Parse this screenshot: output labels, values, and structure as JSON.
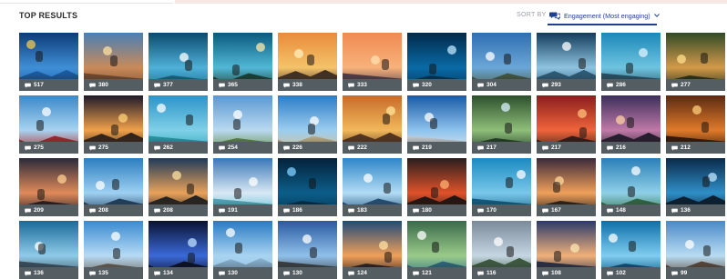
{
  "header": {
    "title": "TOP RESULTS",
    "sort_by_label": "SORT BY",
    "sort_value": "Engagement (Most engaging)",
    "accent_color": "#1f3f8f"
  },
  "results": [
    {
      "count": "517",
      "scene": "lake-mountain-reflection"
    },
    {
      "count": "380",
      "scene": "canyon-boat"
    },
    {
      "count": "377",
      "scene": "surfing-wave"
    },
    {
      "count": "365",
      "scene": "underwater-split-shot"
    },
    {
      "count": "338",
      "scene": "mountain-summit-sunset"
    },
    {
      "count": "333",
      "scene": "skateboard-jump"
    },
    {
      "count": "320",
      "scene": "underwater-cave-diver"
    },
    {
      "count": "304",
      "scene": "coastal-cliffs"
    },
    {
      "count": "293",
      "scene": "surfer-barrel"
    },
    {
      "count": "286",
      "scene": "seal-underwater"
    },
    {
      "count": "277",
      "scene": "forest-sunlight"
    },
    {
      "count": "275",
      "scene": "red-rider-jump"
    },
    {
      "count": "275",
      "scene": "sparks-sunset"
    },
    {
      "count": "262",
      "scene": "boat-clear-water"
    },
    {
      "count": "254",
      "scene": "windmill-meadow"
    },
    {
      "count": "226",
      "scene": "palm-beach"
    },
    {
      "count": "222",
      "scene": "sunset-road"
    },
    {
      "count": "219",
      "scene": "basketball-dunk"
    },
    {
      "count": "217",
      "scene": "waterfall-valley"
    },
    {
      "count": "217",
      "scene": "red-sky-sunset"
    },
    {
      "count": "216",
      "scene": "mountain-bike-dusk"
    },
    {
      "count": "212",
      "scene": "orange-cave"
    },
    {
      "count": "209",
      "scene": "volcanic-rocks-sunset"
    },
    {
      "count": "208",
      "scene": "wakeboard-jump"
    },
    {
      "count": "208",
      "scene": "sunset-plateau"
    },
    {
      "count": "191",
      "scene": "blue-pool-ice"
    },
    {
      "count": "186",
      "scene": "deep-blue-fish"
    },
    {
      "count": "183",
      "scene": "kitesurf-jump"
    },
    {
      "count": "180",
      "scene": "volcano-lava"
    },
    {
      "count": "170",
      "scene": "underwater-swimmer"
    },
    {
      "count": "167",
      "scene": "lantern-sunset"
    },
    {
      "count": "148",
      "scene": "tropical-coast"
    },
    {
      "count": "136",
      "scene": "sea-cave-arch"
    },
    {
      "count": "136",
      "scene": "shark-diver"
    },
    {
      "count": "135",
      "scene": "palm-jump"
    },
    {
      "count": "134",
      "scene": "light-tunnel"
    },
    {
      "count": "130",
      "scene": "skydiver"
    },
    {
      "count": "130",
      "scene": "cyclist-action"
    },
    {
      "count": "124",
      "scene": "bmx-sunset"
    },
    {
      "count": "121",
      "scene": "river-rafting"
    },
    {
      "count": "116",
      "scene": "upside-down-coast"
    },
    {
      "count": "108",
      "scene": "lake-sunset-clouds"
    },
    {
      "count": "102",
      "scene": "diver-sunbeams"
    },
    {
      "count": "99",
      "scene": "dock-hands"
    }
  ],
  "palettes": [
    [
      "#0d3b78",
      "#3f8fd6",
      "#1d5fa8",
      "#f2c94c"
    ],
    [
      "#4a7fb5",
      "#c98a5a",
      "#7a4e33",
      "#ffe0a0"
    ],
    [
      "#0b4a6e",
      "#4fb0d8",
      "#136c8f",
      "#ffffff"
    ],
    [
      "#0a5a7d",
      "#52b7d6",
      "#1a3e2c",
      "#ffe9a8"
    ],
    [
      "#e98b3a",
      "#f4c36a",
      "#3a2b24",
      "#fff2c0"
    ],
    [
      "#f08a52",
      "#f7b27a",
      "#4a3a4f",
      "#ffe0b0"
    ],
    [
      "#012a4a",
      "#0a6aa6",
      "#013a5c",
      "#bfe7ff"
    ],
    [
      "#2f6fb2",
      "#6aa6d8",
      "#4b5b3a",
      "#ffffff"
    ],
    [
      "#123c5a",
      "#8fc3e0",
      "#2b5c7a",
      "#ffffff"
    ],
    [
      "#1b88b8",
      "#6ec4e0",
      "#2a4f63",
      "#e0f4ff"
    ],
    [
      "#314a26",
      "#d39a4a",
      "#1e2e18",
      "#ffe08a"
    ],
    [
      "#3a88c9",
      "#a8d3f0",
      "#b11e1e",
      "#ffffff"
    ],
    [
      "#1e1a2a",
      "#f0a14a",
      "#2a1e1a",
      "#ffd27a"
    ],
    [
      "#2c93c8",
      "#7fd0e8",
      "#27a6b5",
      "#ffffff"
    ],
    [
      "#5a98d2",
      "#b9d9f0",
      "#5f8a3a",
      "#ffffff"
    ],
    [
      "#2b7cc6",
      "#9ccdf0",
      "#d9c08a",
      "#ffffff"
    ],
    [
      "#c76a2a",
      "#f2b85a",
      "#503020",
      "#ffe59a"
    ],
    [
      "#1a5aa6",
      "#8ec3ee",
      "#e6e6e6",
      "#ffffff"
    ],
    [
      "#2c4f2c",
      "#8fbf7a",
      "#1e3a24",
      "#d8f0ff"
    ],
    [
      "#8a1e1e",
      "#f0643a",
      "#2a1a1a",
      "#ffc07a"
    ],
    [
      "#3b2e5a",
      "#c07aa8",
      "#1e1a2a",
      "#ffd0a0"
    ],
    [
      "#5a2a12",
      "#e07a2a",
      "#2a140a",
      "#ffcf7a"
    ],
    [
      "#2a2a3a",
      "#e08a5a",
      "#1a1a22",
      "#ffd090"
    ],
    [
      "#2c7ec0",
      "#9ed0f2",
      "#1a3a5a",
      "#ffffff"
    ],
    [
      "#1e3a5a",
      "#e9a25a",
      "#1a1e22",
      "#ffe2a0"
    ],
    [
      "#3a78b8",
      "#d9e9f4",
      "#4fb8d0",
      "#ffffff"
    ],
    [
      "#04223a",
      "#0c5e8a",
      "#02314e",
      "#7fd0ff"
    ],
    [
      "#2e86c8",
      "#b2dcf5",
      "#1c4c78",
      "#ffffff"
    ],
    [
      "#2a1e1e",
      "#e0522a",
      "#1a1414",
      "#ffb070"
    ],
    [
      "#1b8ac2",
      "#79c8ea",
      "#0f5c86",
      "#ffffff"
    ],
    [
      "#3a2a3a",
      "#f0a05a",
      "#1a1a1a",
      "#ffd89a"
    ],
    [
      "#2b7fb8",
      "#8fd0e8",
      "#2f6a3a",
      "#ffffff"
    ],
    [
      "#0a2a4a",
      "#2f8fc8",
      "#0a1a2a",
      "#bfe6ff"
    ],
    [
      "#1a6a9a",
      "#8fcbe8",
      "#3a4a5a",
      "#ffffff"
    ],
    [
      "#3a8ad0",
      "#b6dbf5",
      "#6a5a4a",
      "#ffffff"
    ],
    [
      "#0a1230",
      "#3a6ad8",
      "#0a0a18",
      "#bfe0ff"
    ],
    [
      "#2a7ac2",
      "#a8d4f2",
      "#8fbad8",
      "#ffffff"
    ],
    [
      "#2a5aa0",
      "#8fc0ea",
      "#3a3a3a",
      "#ffffff"
    ],
    [
      "#1e4a7a",
      "#f0a05a",
      "#1a1a24",
      "#ffe0a0"
    ],
    [
      "#3a6a4a",
      "#9acb8a",
      "#2a6a8a",
      "#ffffff"
    ],
    [
      "#7a8a9a",
      "#c6d6e2",
      "#3a5a3a",
      "#ffffff"
    ],
    [
      "#2a3a6a",
      "#f0b07a",
      "#1a2a4a",
      "#ffe6b0"
    ],
    [
      "#0e6fa8",
      "#7fcdf0",
      "#0a4a78",
      "#ffffff"
    ],
    [
      "#4a8ac8",
      "#b8dcf2",
      "#5a4030",
      "#ffffff"
    ]
  ]
}
